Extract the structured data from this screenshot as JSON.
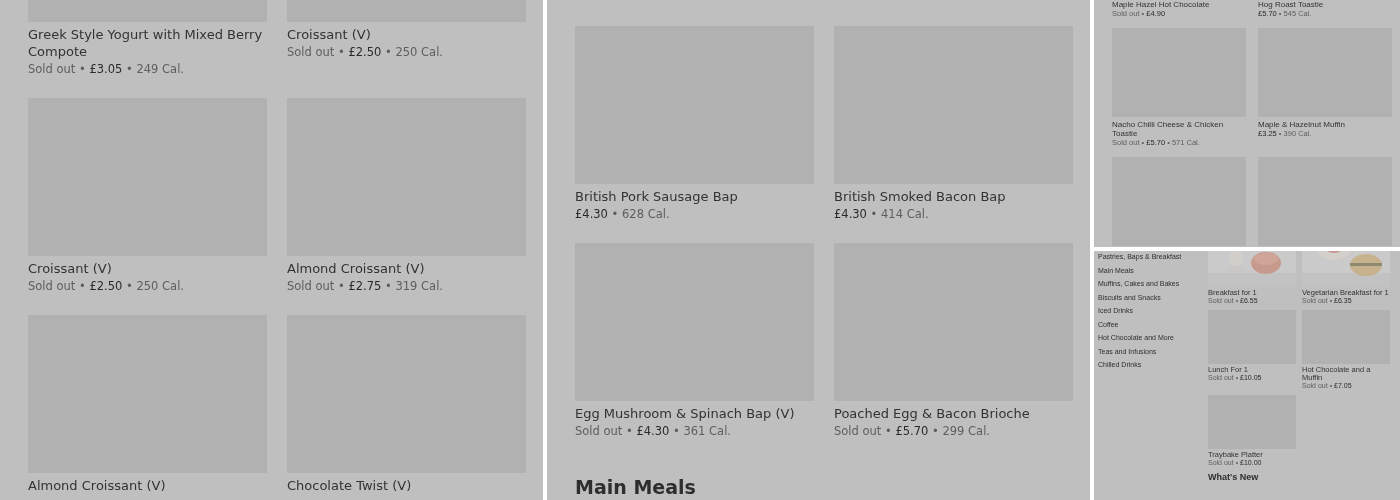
{
  "panels": [
    {
      "kind": "menu",
      "sections": [
        {
          "items": [
            {
              "kind": "tile",
              "title": "Greek Style Yogurt with Mixed Berry Compote",
              "meta": "Sold out • **£3.05** • 249 Cal."
            },
            {
              "kind": "tile",
              "title": "Croissant (V)",
              "meta": "Sold out • **£2.50** • 250 Cal."
            },
            {
              "kind": "tile",
              "title": "Croissant (V)",
              "meta": "Sold out • **£2.50** • 250 Cal."
            },
            {
              "kind": "tile",
              "title": "Almond Croissant (V)",
              "meta": "Sold out • **£2.75** • 319 Cal."
            },
            {
              "kind": "tile",
              "title": "Almond Croissant (V)"
            },
            {
              "kind": "tile",
              "title": "Chocolate Twist (V)"
            }
          ]
        }
      ]
    },
    {
      "kind": "menu",
      "sections": [
        {
          "items": [
            {
              "kind": "tile",
              "title": "British Pork Sausage Bap",
              "meta": "**£4.30** • 628 Cal."
            },
            {
              "kind": "tile",
              "title": "British Smoked Bacon Bap",
              "meta": "**£4.30** • 414 Cal."
            },
            {
              "kind": "tile",
              "title": "Egg Mushroom & Spinach Bap (V)",
              "meta": "Sold out • **£4.30** • 361 Cal."
            },
            {
              "kind": "tile",
              "title": "Poached Egg & Bacon Brioche",
              "meta": "Sold out • **£5.70** • 299 Cal."
            }
          ]
        },
        {
          "heading": "Main Meals"
        }
      ]
    },
    {
      "kind": "menu",
      "sections": [
        {
          "items": [
            {
              "kind": "text-only",
              "title": "Maple Hazel Hot Chocolate",
              "meta": "Sold out • **£4.90**"
            },
            {
              "kind": "text-only",
              "title": "Hog Roast Toastie",
              "meta": "**£5.70** • 545 Cal."
            },
            {
              "kind": "tile",
              "title": "Nacho Chilli Cheese & Chicken Toastie",
              "meta": "Sold out • **£5.70** • 571 Cal."
            },
            {
              "kind": "tile",
              "title": "Maple & Hazelnut Muffin",
              "meta": "**£3.25** • 390 Cal."
            },
            {
              "kind": "tile"
            },
            {
              "kind": "tile"
            }
          ]
        }
      ]
    },
    {
      "kind": "menu-with-sidebar",
      "sidebar": {
        "items": [
          "Pastries, Baps & Breakfast",
          "Main Meals",
          "Muffins, Cakes and Bakes",
          "Biscuits and Snacks",
          "Iced Drinks",
          "Coffee",
          "Hot Chocolate and More",
          "Teas and Infusions",
          "Chilled Drinks"
        ]
      },
      "sections": [
        {
          "items": [
            {
              "kind": "picture",
              "title": "Breakfast for 1",
              "meta": "Sold out • **£6.55**"
            },
            {
              "kind": "picture",
              "title": "Vegetarian Breakfast for 1",
              "meta": "Sold out • **£6.35**"
            },
            {
              "kind": "tile",
              "title": "Lunch For 1",
              "meta": "Sold out • **£10.05**"
            },
            {
              "kind": "tile",
              "title": "Hot Chocolate and a Muffin",
              "meta": "Sold out • **£7.05**"
            },
            {
              "kind": "tile",
              "title": "Traybake Platter",
              "meta": "Sold out • **£10.00**"
            }
          ]
        },
        {
          "heading": "What's New"
        }
      ]
    }
  ]
}
